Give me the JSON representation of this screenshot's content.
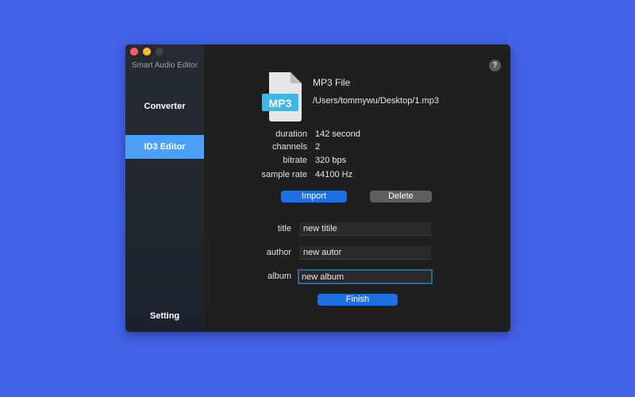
{
  "app_title": "Smart Audio Editor",
  "nav": {
    "converter": "Converter",
    "id3": "ID3 Editor",
    "setting": "Setting"
  },
  "help": "?",
  "file": {
    "badge": "MP3",
    "type": "MP3 File",
    "path": "/Users/tommywu/Desktop/1.mp3"
  },
  "info": [
    {
      "label": "duration",
      "value": "142 second"
    },
    {
      "label": "channels",
      "value": "2"
    },
    {
      "label": "bitrate",
      "value": "320 bps"
    },
    {
      "label": "sample rate",
      "value": "44100 Hz"
    }
  ],
  "buttons": {
    "import": "Import",
    "delete": "Delete",
    "finish": "Finish"
  },
  "fields": [
    {
      "label": "title",
      "value": "new titile"
    },
    {
      "label": "author",
      "value": "new autor"
    },
    {
      "label": "album",
      "value": "new album"
    }
  ],
  "colors": {
    "accent": "#1f6fe0",
    "selected": "#4aa1f5",
    "background": "#4262e8"
  }
}
